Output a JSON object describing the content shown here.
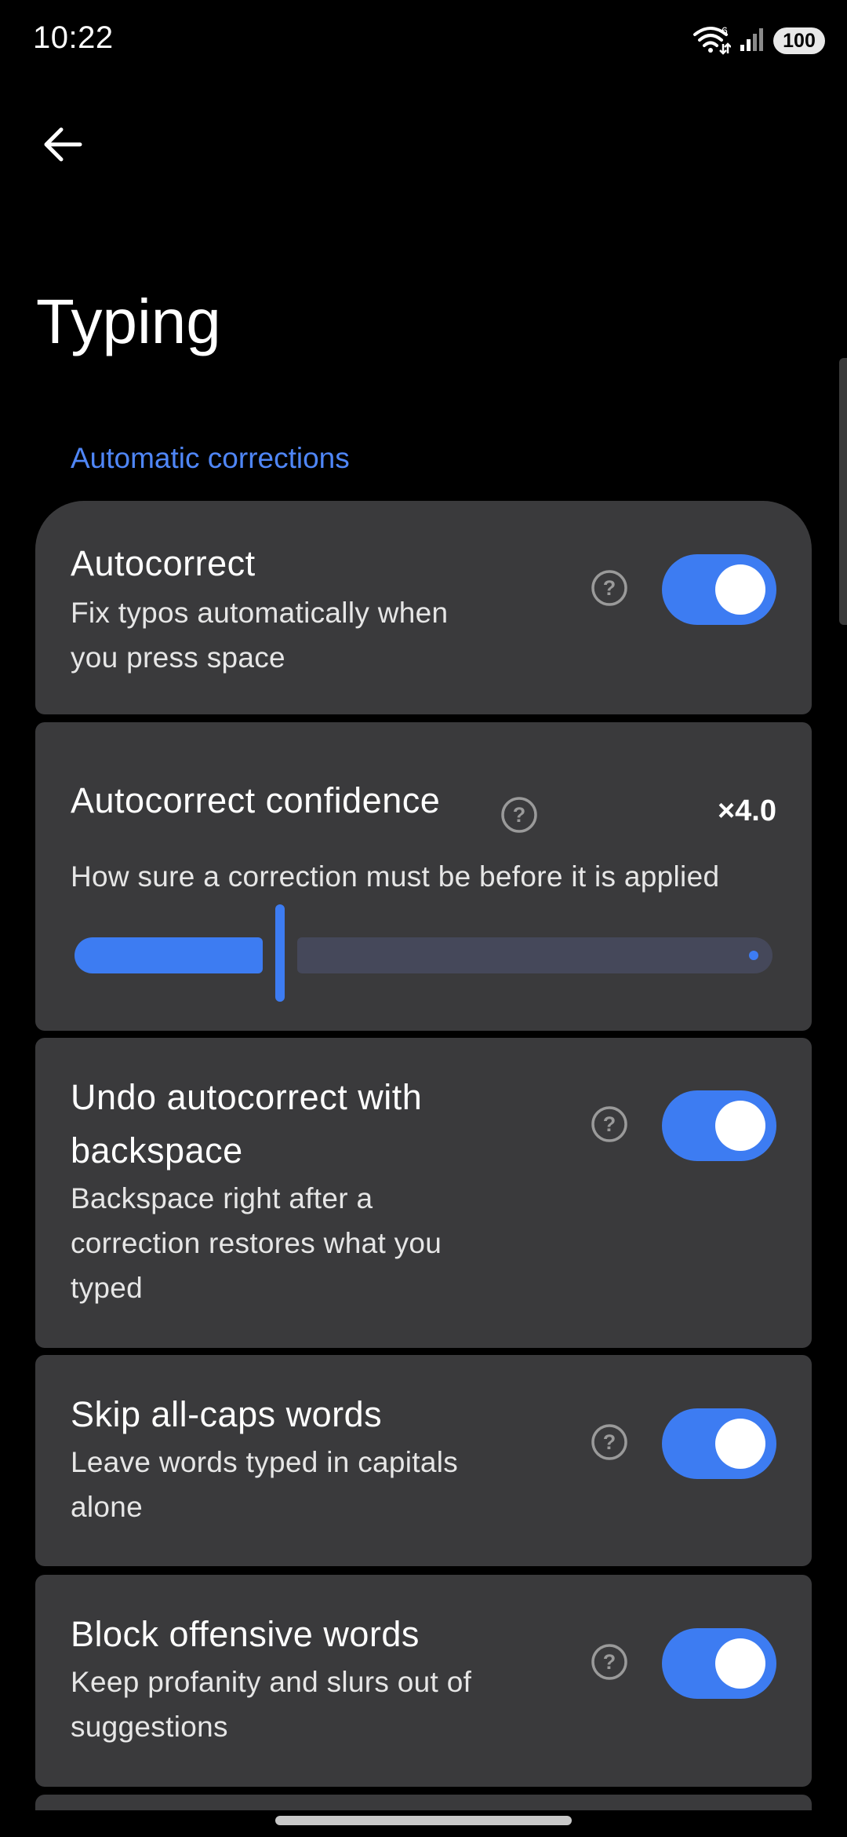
{
  "status_bar": {
    "time": "10:22",
    "battery": "100",
    "wifi_badge": "6"
  },
  "header": {
    "title": "Typing"
  },
  "section": {
    "label": "Automatic corrections"
  },
  "settings": {
    "autocorrect": {
      "title": "Autocorrect",
      "desc_line1": "Fix typos automatically when",
      "desc_line2": "you press space",
      "enabled": true
    },
    "confidence": {
      "title": "Autocorrect confidence",
      "value": "×4.0",
      "desc": "How sure a correction must be before it is applied",
      "fraction": 0.28
    },
    "undo": {
      "title_line1": "Undo autocorrect with",
      "title_line2": "backspace",
      "desc_line1": "Backspace right after a",
      "desc_line2": "correction restores what you",
      "desc_line3": "typed",
      "enabled": true
    },
    "skip_caps": {
      "title": "Skip all-caps words",
      "desc_line1": "Leave words typed in capitals",
      "desc_line2": "alone",
      "enabled": true
    },
    "block_offensive": {
      "title": "Block offensive words",
      "desc_line1": "Keep profanity and slurs out of",
      "desc_line2": "suggestions",
      "enabled": true
    }
  },
  "colors": {
    "accent": "#3d7cf2",
    "section_label": "#4f86f7",
    "card_bg": "#3a3a3c",
    "background": "#000000"
  },
  "icons": {
    "back": "arrow-left-icon",
    "help": "question-circle-icon",
    "wifi": "wifi-icon",
    "signal": "signal-icon"
  }
}
